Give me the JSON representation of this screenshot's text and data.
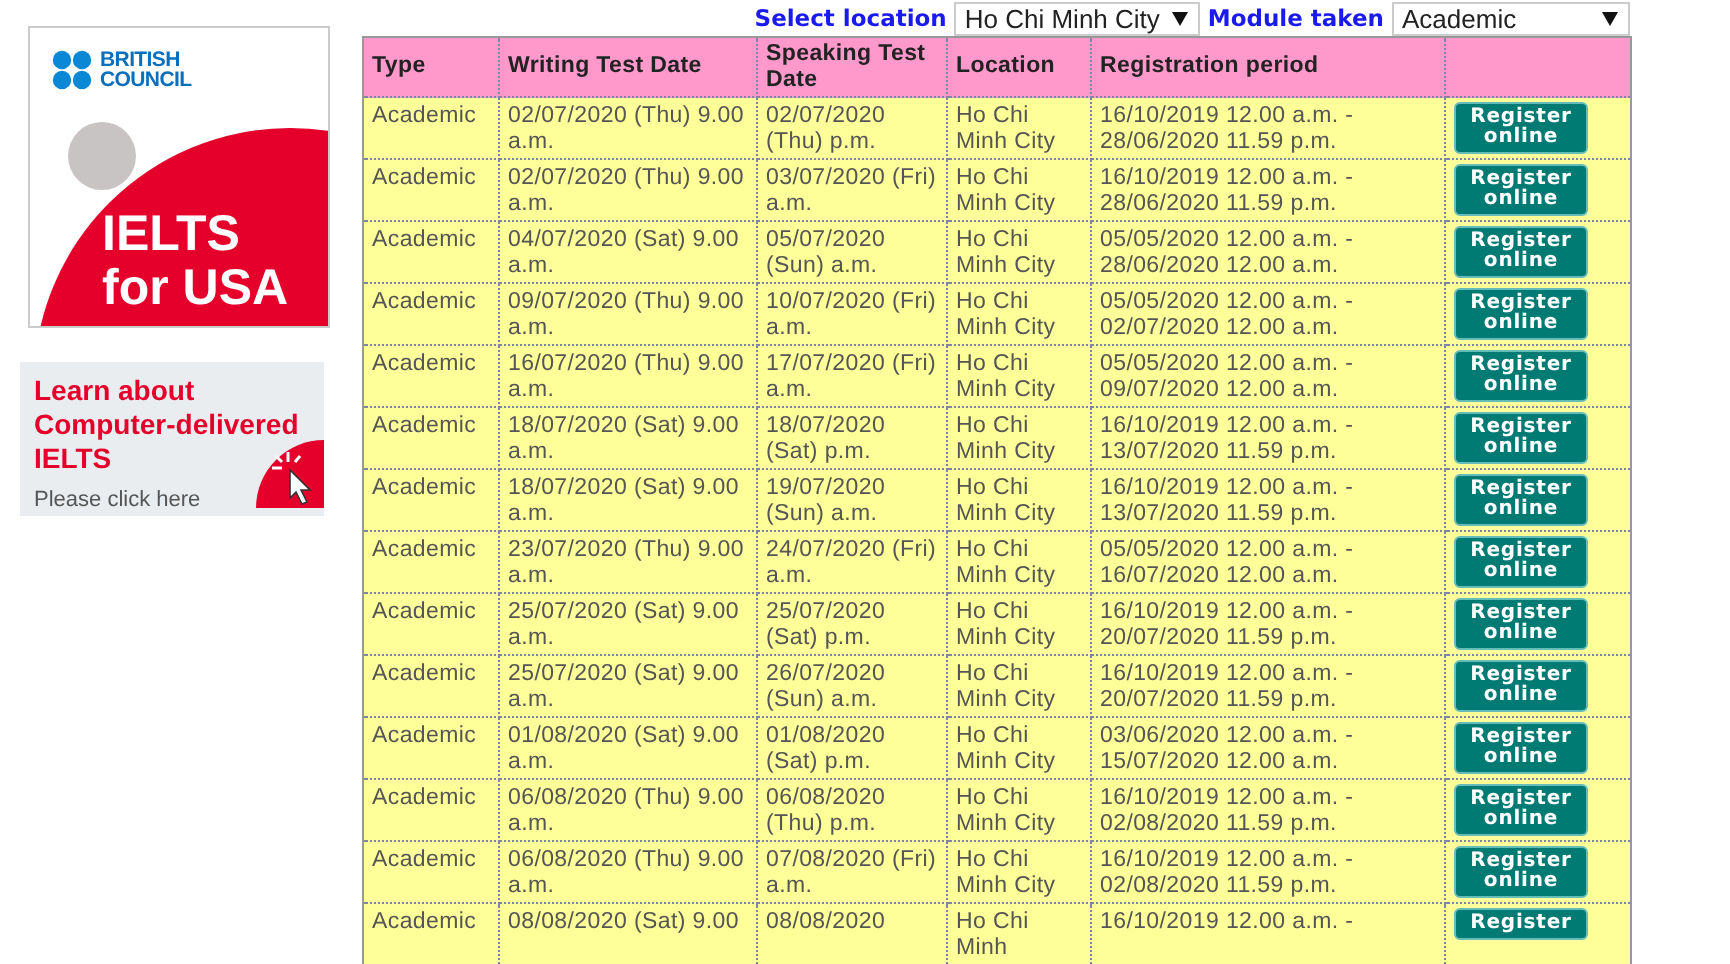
{
  "sidebar": {
    "logo": {
      "brand": [
        "BRITISH",
        "COUNCIL"
      ],
      "title": [
        "IELTS",
        "for USA"
      ]
    },
    "banner": {
      "headline": "Learn about Computer-delivered IELTS",
      "link": "Please click here"
    }
  },
  "filters": [
    {
      "label": "Select location",
      "value": "Ho Chi Minh City"
    },
    {
      "label": "Module taken",
      "value": "Academic"
    }
  ],
  "table": {
    "columns": [
      "Type",
      "Writing Test Date",
      "Speaking Test Date",
      "Location",
      "Registration period"
    ],
    "rows": [
      {
        "type": "Academic",
        "writing": "02/07/2020 (Thu) 9.00 a.m.",
        "speaking": "02/07/2020 (Thu) p.m.",
        "location": "Ho Chi Minh City",
        "period": "16/10/2019 12.00 a.m. - 28/06/2020 11.59 p.m.",
        "action": "Register online"
      },
      {
        "type": "Academic",
        "writing": "02/07/2020 (Thu) 9.00 a.m.",
        "speaking": "03/07/2020 (Fri) a.m.",
        "location": "Ho Chi Minh City",
        "period": "16/10/2019 12.00 a.m. - 28/06/2020 11.59 p.m.",
        "action": "Register online"
      },
      {
        "type": "Academic",
        "writing": "04/07/2020 (Sat) 9.00 a.m.",
        "speaking": "05/07/2020 (Sun) a.m.",
        "location": "Ho Chi Minh City",
        "period": "05/05/2020 12.00 a.m. - 28/06/2020 12.00 a.m.",
        "action": "Register online"
      },
      {
        "type": "Academic",
        "writing": "09/07/2020 (Thu) 9.00 a.m.",
        "speaking": "10/07/2020 (Fri) a.m.",
        "location": "Ho Chi Minh City",
        "period": "05/05/2020 12.00 a.m. - 02/07/2020 12.00 a.m.",
        "action": "Register online"
      },
      {
        "type": "Academic",
        "writing": "16/07/2020 (Thu) 9.00 a.m.",
        "speaking": "17/07/2020 (Fri) a.m.",
        "location": "Ho Chi Minh City",
        "period": "05/05/2020 12.00 a.m. - 09/07/2020 12.00 a.m.",
        "action": "Register online"
      },
      {
        "type": "Academic",
        "writing": "18/07/2020 (Sat) 9.00 a.m.",
        "speaking": "18/07/2020 (Sat) p.m.",
        "location": "Ho Chi Minh City",
        "period": "16/10/2019 12.00 a.m. - 13/07/2020 11.59 p.m.",
        "action": "Register online"
      },
      {
        "type": "Academic",
        "writing": "18/07/2020 (Sat) 9.00 a.m.",
        "speaking": "19/07/2020 (Sun) a.m.",
        "location": "Ho Chi Minh City",
        "period": "16/10/2019 12.00 a.m. - 13/07/2020 11.59 p.m.",
        "action": "Register online"
      },
      {
        "type": "Academic",
        "writing": "23/07/2020 (Thu) 9.00 a.m.",
        "speaking": "24/07/2020 (Fri) a.m.",
        "location": "Ho Chi Minh City",
        "period": "05/05/2020 12.00 a.m. - 16/07/2020 12.00 a.m.",
        "action": "Register online"
      },
      {
        "type": "Academic",
        "writing": "25/07/2020 (Sat) 9.00 a.m.",
        "speaking": "25/07/2020 (Sat) p.m.",
        "location": "Ho Chi Minh City",
        "period": "16/10/2019 12.00 a.m. - 20/07/2020 11.59 p.m.",
        "action": "Register online"
      },
      {
        "type": "Academic",
        "writing": "25/07/2020 (Sat) 9.00 a.m.",
        "speaking": "26/07/2020 (Sun) a.m.",
        "location": "Ho Chi Minh City",
        "period": "16/10/2019 12.00 a.m. - 20/07/2020 11.59 p.m.",
        "action": "Register online"
      },
      {
        "type": "Academic",
        "writing": "01/08/2020 (Sat) 9.00 a.m.",
        "speaking": "01/08/2020 (Sat) p.m.",
        "location": "Ho Chi Minh City",
        "period": "03/06/2020 12.00 a.m. - 15/07/2020 12.00 a.m.",
        "action": "Register online"
      },
      {
        "type": "Academic",
        "writing": "06/08/2020 (Thu) 9.00 a.m.",
        "speaking": "06/08/2020 (Thu) p.m.",
        "location": "Ho Chi Minh City",
        "period": "16/10/2019 12.00 a.m. - 02/08/2020 11.59 p.m.",
        "action": "Register online"
      },
      {
        "type": "Academic",
        "writing": "06/08/2020 (Thu) 9.00 a.m.",
        "speaking": "07/08/2020 (Fri) a.m.",
        "location": "Ho Chi Minh City",
        "period": "16/10/2019 12.00 a.m. - 02/08/2020 11.59 p.m.",
        "action": "Register online"
      },
      {
        "type": "Academic",
        "writing": "08/08/2020 (Sat) 9.00",
        "speaking": "08/08/2020",
        "location": "Ho Chi Minh",
        "period": "16/10/2019 12.00 a.m. -",
        "action": "Register"
      }
    ]
  }
}
